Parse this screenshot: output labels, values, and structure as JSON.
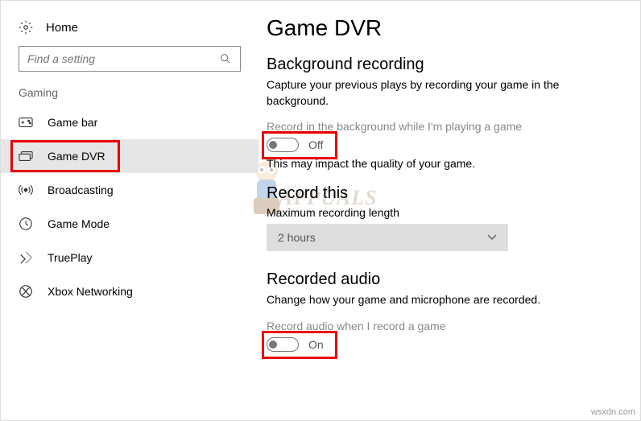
{
  "sidebar": {
    "home_label": "Home",
    "search_placeholder": "Find a setting",
    "section_title": "Gaming",
    "items": [
      {
        "label": "Game bar"
      },
      {
        "label": "Game DVR"
      },
      {
        "label": "Broadcasting"
      },
      {
        "label": "Game Mode"
      },
      {
        "label": "TruePlay"
      },
      {
        "label": "Xbox Networking"
      }
    ]
  },
  "main": {
    "title": "Game DVR",
    "bg_recording": {
      "heading": "Background recording",
      "desc": "Capture your previous plays by recording your game in the background.",
      "label": "Record in the background while I'm playing a game",
      "toggle_text": "Off",
      "note": "This may impact the quality of your game."
    },
    "record_this": {
      "heading": "Record this",
      "label": "Maximum recording length",
      "value": "2 hours"
    },
    "recorded_audio": {
      "heading": "Recorded audio",
      "desc": "Change how your game and microphone are recorded.",
      "label": "Record audio when I record a game",
      "toggle_text": "On"
    }
  },
  "watermark": "APPUALS",
  "attribution": "wsxdn.com"
}
